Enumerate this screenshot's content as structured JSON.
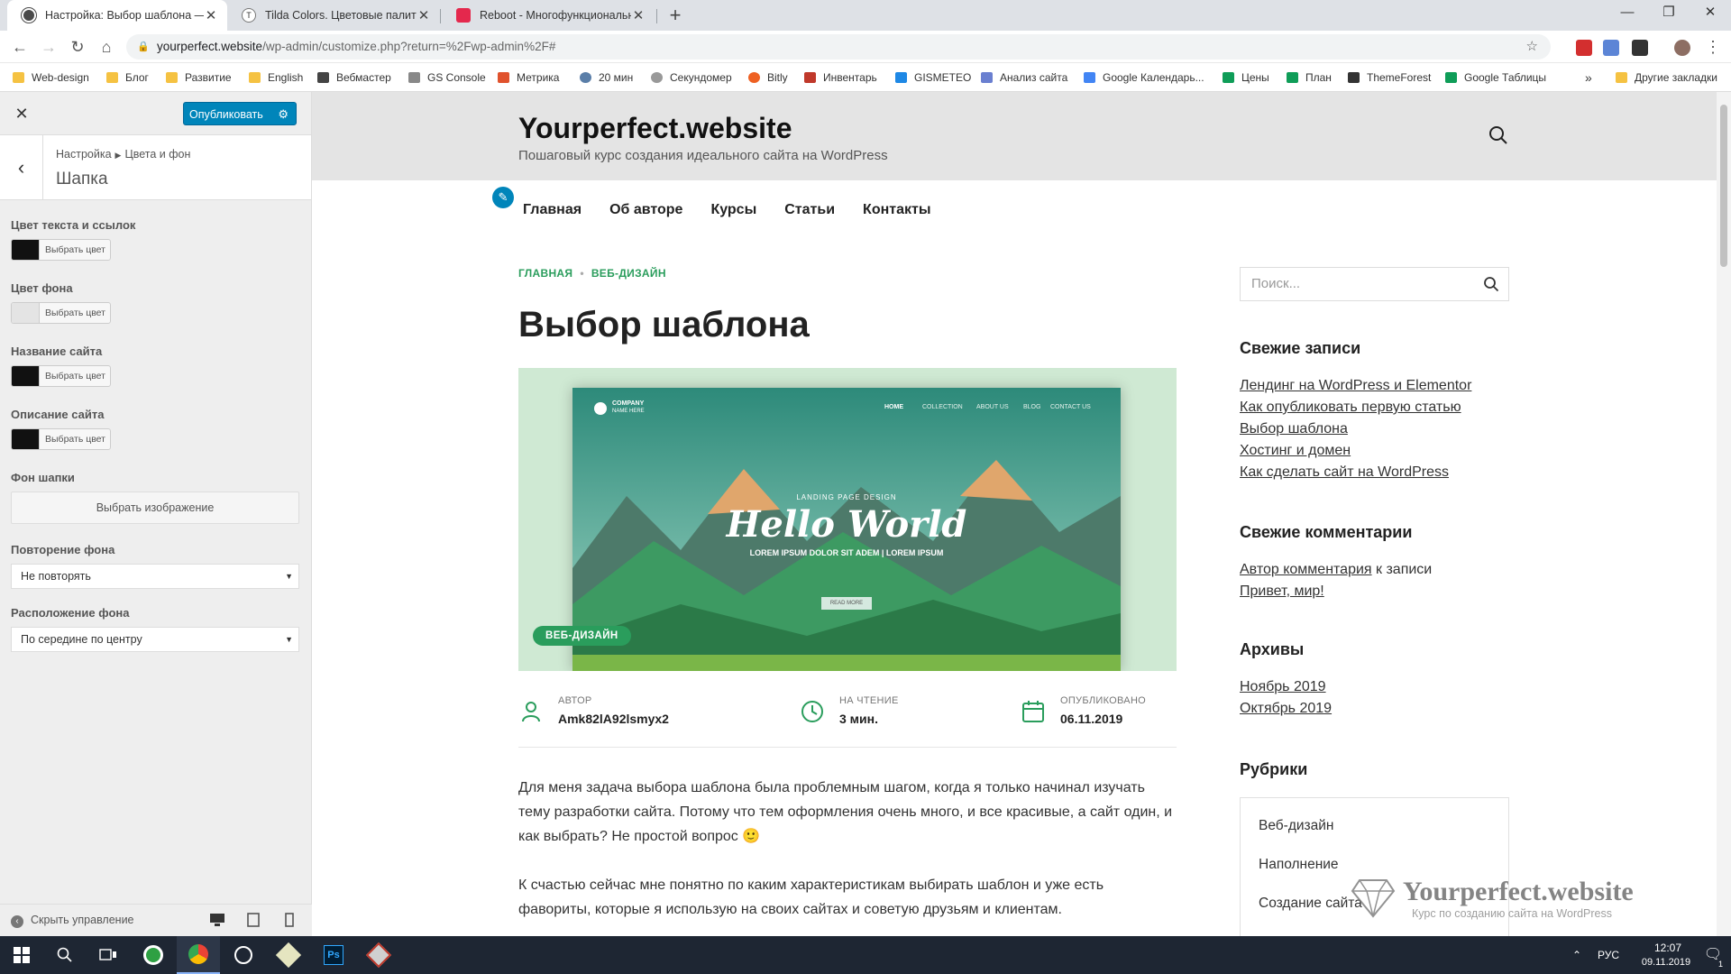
{
  "browser": {
    "tabs": [
      {
        "title": "Настройка: Выбор шаблона — ",
        "fav_color": "#4a4a4a"
      },
      {
        "title": "Tilda Colors. Цветовые палитры",
        "fav_color": "#777777"
      },
      {
        "title": "Reboot - Многофункциональн",
        "fav_color": "#e4284d"
      }
    ],
    "url_host": "yourperfect.website",
    "url_path": "/wp-admin/customize.php?return=%2Fwp-admin%2F#",
    "bookmarks": [
      {
        "label": "Web-design",
        "color": "#f5c242"
      },
      {
        "label": "Блог",
        "color": "#f5c242"
      },
      {
        "label": "Развитие",
        "color": "#f5c242"
      },
      {
        "label": "English",
        "color": "#f5c242"
      },
      {
        "label": "Вебмастер",
        "color": "#444444"
      },
      {
        "label": "GS Console",
        "color": "#888888"
      },
      {
        "label": "Метрика",
        "color": "#e0522d"
      },
      {
        "label": "20 мин",
        "color": "#5a7ea8"
      },
      {
        "label": "Секундомер",
        "color": "#999999"
      },
      {
        "label": "Bitly",
        "color": "#ee6123"
      },
      {
        "label": "Инвентарь",
        "color": "#c0392b"
      },
      {
        "label": "GISMETEO",
        "color": "#1e88e5"
      },
      {
        "label": "Анализ сайта",
        "color": "#6a7fd0"
      },
      {
        "label": "Google Календарь...",
        "color": "#4285f4"
      },
      {
        "label": "Цены",
        "color": "#0f9d58"
      },
      {
        "label": "План",
        "color": "#0f9d58"
      },
      {
        "label": "ThemeForest",
        "color": "#333333"
      },
      {
        "label": "Google Таблицы",
        "color": "#0f9d58"
      }
    ],
    "more": "»",
    "other_bookmarks": "Другие закладки"
  },
  "customizer": {
    "publish": "Опубликовать",
    "breadcrumb": [
      "Настройка",
      "Цвета и фон"
    ],
    "section_title": "Шапка",
    "color_button": "Выбрать цвет",
    "controls": [
      {
        "label": "Цвет текста и ссылок",
        "swatch": "#111111"
      },
      {
        "label": "Цвет фона",
        "swatch": "#e4e4e4"
      },
      {
        "label": "Название сайта",
        "swatch": "#111111"
      },
      {
        "label": "Описание сайта",
        "swatch": "#111111"
      }
    ],
    "header_bg_label": "Фон шапки",
    "choose_image": "Выбрать изображение",
    "repeat_label": "Повторение фона",
    "repeat_value": "Не повторять",
    "position_label": "Расположение фона",
    "position_value": "По середине по центру",
    "hide_controls": "Скрыть управление"
  },
  "site": {
    "name": "Yourperfect.website",
    "description": "Пошаговый курс создания идеального сайта на WordPress",
    "menu": [
      "Главная",
      "Об авторе",
      "Курсы",
      "Статьи",
      "Контакты"
    ],
    "breadcrumb": [
      "ГЛАВНАЯ",
      "ВЕБ-ДИЗАЙН"
    ],
    "post_title": "Выбор шаблона",
    "hero": {
      "company": "COMPANY",
      "company_sub": "NAME HERE",
      "nav": [
        "HOME",
        "COLLECTION",
        "ABOUT US",
        "BLOG",
        "CONTACT US"
      ],
      "kicker": "LANDING PAGE DESIGN",
      "headline": "Hello World",
      "tagline": "LOREM IPSUM DOLOR SIT ADEM | LOREM IPSUM",
      "button": "READ MORE"
    },
    "badge": "ВЕБ-ДИЗАЙН",
    "meta": [
      {
        "label": "АВТОР",
        "value": "Amk82lA92lsmyx2"
      },
      {
        "label": "НА ЧТЕНИЕ",
        "value": "3 мин."
      },
      {
        "label": "ОПУБЛИКОВАНО",
        "value": "06.11.2019"
      }
    ],
    "paragraphs": [
      "Для меня задача выбора шаблона была проблемным шагом, когда я только начинал изучать тему разработки сайта. Потому что тем оформления очень много, и все красивые, а сайт один, и как выбрать? Не простой вопрос 🙂",
      "К счастью сейчас мне понятно по каким характеристикам выбирать шаблон и уже есть фавориты, которые я использую на своих сайтах и советую друзьям и клиентам."
    ],
    "search_placeholder": "Поиск...",
    "recent_posts_title": "Свежие записи",
    "recent_posts": [
      "Лендинг на WordPress и Elementor",
      "Как опубликовать первую статью",
      "Выбор шаблона",
      "Хостинг и домен",
      "Как сделать сайт на WordPress"
    ],
    "recent_comments_title": "Свежие комментарии",
    "comment_author": "Автор комментария",
    "comment_mid": " к записи ",
    "comment_post": "Привет, мир!",
    "archives_title": "Архивы",
    "archives": [
      "Ноябрь 2019",
      "Октябрь 2019"
    ],
    "categories_title": "Рубрики",
    "categories": [
      "Веб-дизайн",
      "Наполнение",
      "Создание сайта"
    ],
    "watermark_title": "Yourperfect.website",
    "watermark_sub": "Курс по созданию сайта на WordPress"
  },
  "taskbar": {
    "lang": "РУС",
    "time": "12:07",
    "date": "09.11.2019",
    "notifications": "1"
  }
}
